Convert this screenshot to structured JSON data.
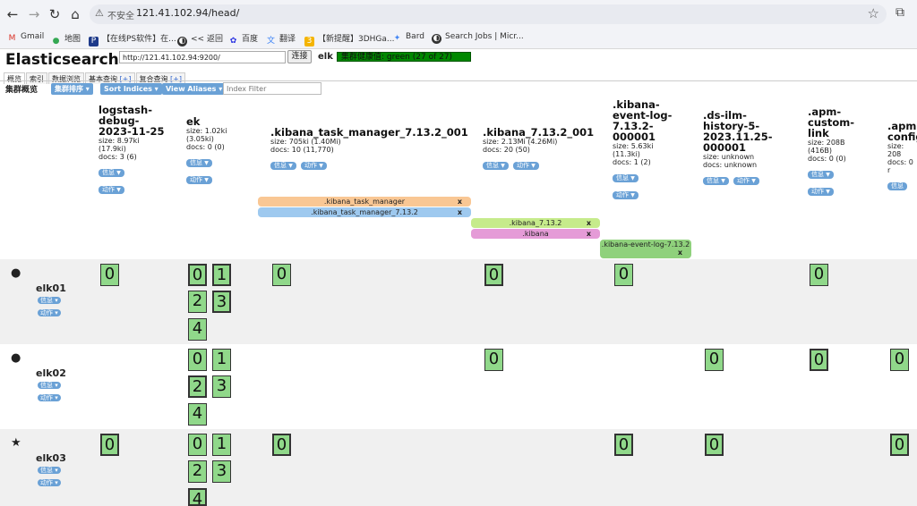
{
  "browser": {
    "security_label": "不安全",
    "url": "121.41.102.94/head/",
    "bookmarks": [
      "Gmail",
      "地图",
      "【在线PS软件】在...",
      "<< 返回",
      "百度",
      "翻译",
      "【新提醒】3DHGa...",
      "Bard",
      "Search Jobs | Micr..."
    ]
  },
  "app": {
    "title": "Elasticsearch",
    "connect_url": "http://121.41.102.94:9200/",
    "connect_label": "连接",
    "cluster_name": "elk",
    "health": "集群健康值: green (27 of 27)",
    "tabs": [
      "概览",
      "索引",
      "数据浏览",
      "基本查询",
      "[+]",
      "复合查询",
      "[+]"
    ],
    "overview_title": "集群概览",
    "sort_cluster": "集群排序",
    "sort_indices": "Sort Indices",
    "view_aliases": "View Aliases",
    "filter_placeholder": "Index Filter",
    "info_label": "信息",
    "action_label": "动作"
  },
  "indices": [
    {
      "name": "logstash-debug-2023-11-25",
      "name_lines": [
        "logstash-",
        "debug-",
        "2023-11-25"
      ],
      "size": "size: 8.97ki",
      "size2": "(17.9ki)",
      "docs": "docs: 3 (6)"
    },
    {
      "name": "ek",
      "name_lines": [
        "ek"
      ],
      "size": "size: 1.02ki",
      "size2": "(3.05ki)",
      "docs": "docs: 0 (0)"
    },
    {
      "name": ".kibana_task_manager_7.13.2_001",
      "name_lines": [
        ".kibana_task_manager_7.13.2_001"
      ],
      "size": "size: 705ki (1.40Mi)",
      "size2": "",
      "docs": "docs: 10 (11,770)"
    },
    {
      "name": ".kibana_7.13.2_001",
      "name_lines": [
        ".kibana_7.13.2_001"
      ],
      "size": "size: 2.13Mi (4.26Mi)",
      "size2": "",
      "docs": "docs: 20 (50)"
    },
    {
      "name": ".kibana-event-log-7.13.2-000001",
      "name_lines": [
        ".kibana-",
        "event-log-",
        "7.13.2-",
        "000001"
      ],
      "size": "size: 5.63ki",
      "size2": "(11.3ki)",
      "docs": "docs: 1 (2)"
    },
    {
      "name": ".ds-ilm-history-5-2023.11.25-000001",
      "name_lines": [
        ".ds-ilm-",
        "history-5-",
        "2023.11.25-",
        "000001"
      ],
      "size": "size: unknown",
      "size2": "",
      "docs": "docs: unknown"
    },
    {
      "name": ".apm-custom-link",
      "name_lines": [
        ".apm-",
        "custom-",
        "link"
      ],
      "size": "size: 208B",
      "size2": "(416B)",
      "docs": "docs: 0 (0)"
    },
    {
      "name": ".apm-config",
      "name_lines": [
        ".apm-",
        "config"
      ],
      "size": "size: 208",
      "size2": "",
      "docs": "docs: 0 r"
    }
  ],
  "aliases": [
    {
      "label": ".kibana_task_manager",
      "color": "#f9c794"
    },
    {
      "label": ".kibana_task_manager_7.13.2",
      "color": "#9ec9ef"
    },
    {
      "label": ".kibana_7.13.2",
      "color": "#c6eb8b"
    },
    {
      "label": ".kibana",
      "color": "#e59bd7"
    },
    {
      "label": ".kibana-event-log-7.13.2",
      "color": "#8fd17c"
    }
  ],
  "alias_close": "x",
  "nodes": [
    {
      "name": "elk01",
      "icon": "●",
      "icon_name": "node-dot-icon"
    },
    {
      "name": "elk02",
      "icon": "●",
      "icon_name": "node-dot-icon"
    },
    {
      "name": "elk03",
      "icon": "★",
      "icon_name": "master-star-icon"
    }
  ],
  "shards": {
    "elk01": {
      "logstash": [
        "0"
      ],
      "ek": [
        "0",
        "1",
        "2",
        "3",
        "4"
      ],
      "task": [
        "0"
      ],
      "kibana": [
        "0"
      ],
      "event": [
        "0"
      ],
      "apm_custom": [
        "0"
      ]
    },
    "elk02": {
      "ek": [
        "0",
        "1",
        "2",
        "3",
        "4"
      ],
      "kibana": [
        "0"
      ],
      "ilm": [
        "0"
      ],
      "apm_custom": [
        "0"
      ],
      "apm_config": [
        "0"
      ]
    },
    "elk03": {
      "logstash": [
        "0"
      ],
      "ek": [
        "0",
        "1",
        "2",
        "3",
        "4"
      ],
      "task": [
        "0"
      ],
      "event": [
        "0"
      ],
      "ilm": [
        "0"
      ],
      "apm_config": [
        "0"
      ]
    }
  }
}
